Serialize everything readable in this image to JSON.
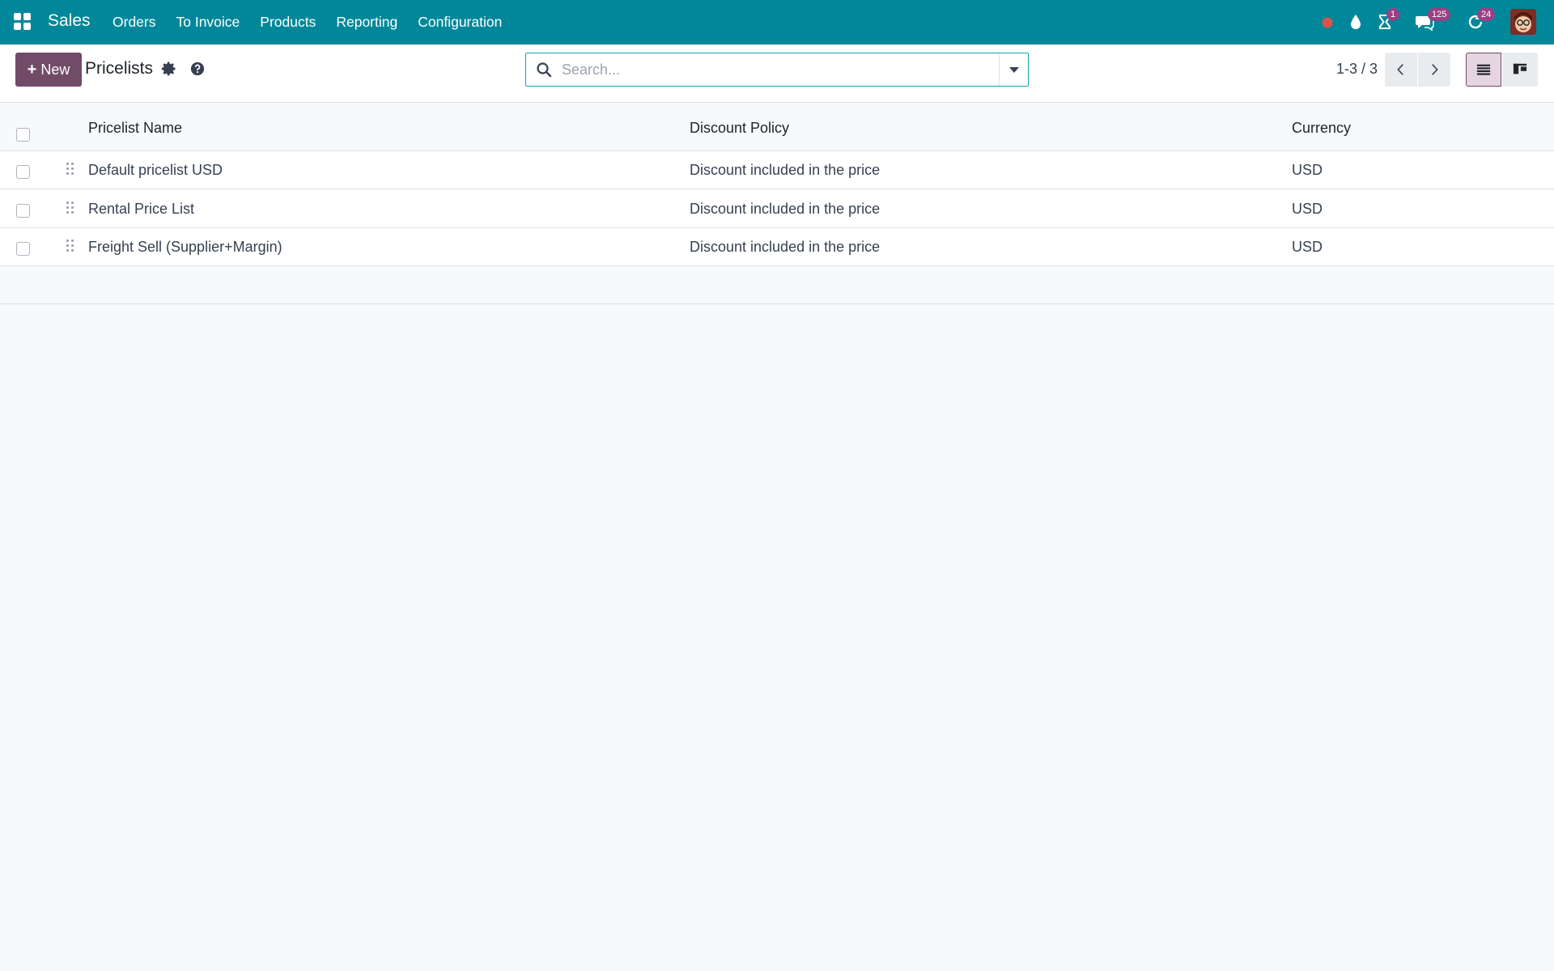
{
  "navbar": {
    "brand": "Sales",
    "menu": [
      "Orders",
      "To Invoice",
      "Products",
      "Reporting",
      "Configuration"
    ],
    "badges": {
      "activities": "1",
      "messages": "125",
      "updates": "24"
    },
    "colors": {
      "navbar_bg": "#00889a",
      "badge_bg": "#9c4083",
      "record_dot": "#e34b4b"
    }
  },
  "control_panel": {
    "new_label": "New",
    "title": "Pricelists",
    "search_placeholder": "Search...",
    "pager": "1-3 / 3",
    "colors": {
      "primary": "#714b67",
      "search_border": "#17a2b8"
    }
  },
  "table": {
    "columns": [
      "Pricelist Name",
      "Discount Policy",
      "Currency"
    ],
    "rows": [
      {
        "name": "Default pricelist USD",
        "policy": "Discount included in the price",
        "currency": "USD"
      },
      {
        "name": "Rental Price List",
        "policy": "Discount included in the price",
        "currency": "USD"
      },
      {
        "name": "Freight Sell (Supplier+Margin)",
        "policy": "Discount included in the price",
        "currency": "USD"
      }
    ]
  }
}
